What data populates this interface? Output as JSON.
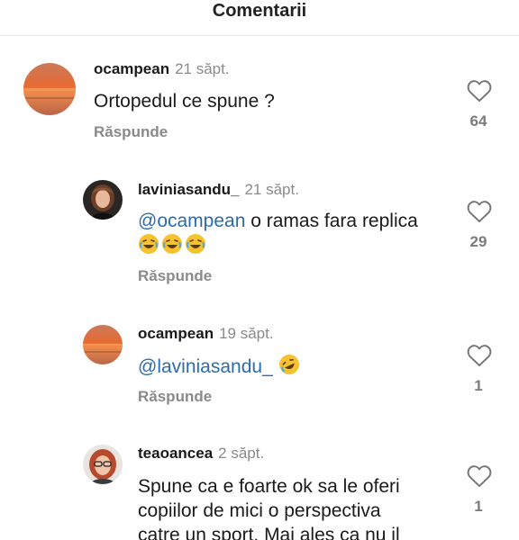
{
  "header": {
    "title": "Comentarii"
  },
  "comments": [
    {
      "username": "ocampean",
      "time": "21 săpt.",
      "text": "Ortopedul ce spune ?",
      "reply_label": "Răspunde",
      "likes": "64"
    },
    {
      "username": "laviniasandu_",
      "time": "21 săpt.",
      "mention": "@ocampean",
      "text": " o ramas fara replica",
      "emojis": [
        "laughing-tears-emoji",
        "laughing-tears-emoji",
        "laughing-tears-emoji"
      ],
      "reply_label": "Răspunde",
      "likes": "29"
    },
    {
      "username": "ocampean",
      "time": "19 săpt.",
      "mention": "@laviniasandu_",
      "emojis": [
        "rolling-laughing-emoji"
      ],
      "reply_label": "Răspunde",
      "likes": "1"
    },
    {
      "username": "teaoancea",
      "time": "2 săpt.",
      "lines": [
        "Spune ca e foarte ok sa le oferi",
        "copiilor de mici o perspectiva",
        "catre un sport. Mai ales ca nu il"
      ],
      "likes": "1"
    }
  ],
  "colors": {
    "mention": "#2b6cb0",
    "muted": "#8a8a8a"
  }
}
